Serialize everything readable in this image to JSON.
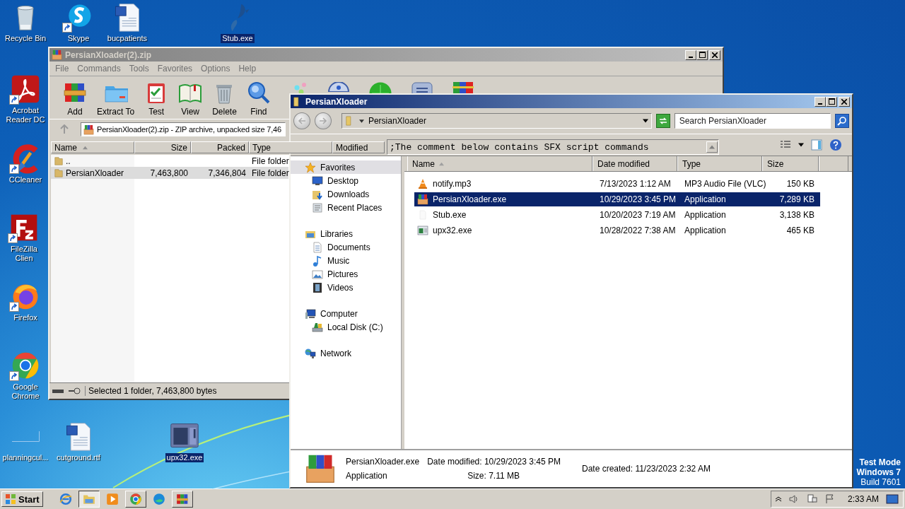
{
  "desktop_icons": [
    {
      "label": "Recycle Bin",
      "kind": "bin",
      "shortcut": false,
      "selected": false
    },
    {
      "label": "Skype",
      "kind": "skype",
      "shortcut": true,
      "selected": false
    },
    {
      "label": "bucpatients",
      "kind": "document",
      "shortcut": false,
      "selected": false
    },
    {
      "label": "Stub.exe",
      "kind": "feather",
      "shortcut": false,
      "selected": true
    },
    {
      "label": "Acrobat Reader DC",
      "kind": "acrobat",
      "shortcut": true,
      "selected": false
    },
    {
      "label": "CCleaner",
      "kind": "cleaner",
      "shortcut": true,
      "selected": false
    },
    {
      "label": "FileZilla Clien",
      "kind": "filezilla",
      "shortcut": true,
      "selected": false
    },
    {
      "label": "Firefox",
      "kind": "firefox",
      "shortcut": true,
      "selected": false
    },
    {
      "label": "Google Chrome",
      "kind": "chrome",
      "shortcut": true,
      "selected": false
    },
    {
      "label": "planningcul...",
      "kind": "blank",
      "shortcut": false,
      "selected": false
    },
    {
      "label": "cutground.rtf",
      "kind": "document",
      "shortcut": false,
      "selected": false
    },
    {
      "label": "upx32.exe",
      "kind": "window",
      "shortcut": false,
      "selected": true
    }
  ],
  "archiver": {
    "title": "PersianXloader(2).zip",
    "active": false,
    "menu": [
      "File",
      "Commands",
      "Tools",
      "Favorites",
      "Options",
      "Help"
    ],
    "toolbar": [
      {
        "label": "Add",
        "kind": "add"
      },
      {
        "label": "Extract To",
        "kind": "extract"
      },
      {
        "label": "Test",
        "kind": "test"
      },
      {
        "label": "View",
        "kind": "view"
      },
      {
        "label": "Delete",
        "kind": "delete"
      },
      {
        "label": "Find",
        "kind": "find"
      }
    ],
    "path": "PersianXloader(2).zip - ZIP archive, unpacked size 7,46",
    "columns": [
      "Name",
      "Size",
      "Packed",
      "Type",
      "Modified"
    ],
    "rows": [
      {
        "name": "..",
        "type": "File folder",
        "selected": false
      },
      {
        "name": "PersianXloader",
        "size": "7,463,800",
        "packed": "7,346,804",
        "type": "File folder",
        "selected": true
      }
    ],
    "comment": ";The comment below contains SFX script commands",
    "status": "Selected 1 folder, 7,463,800 bytes"
  },
  "explorer": {
    "title": "PersianXloader",
    "active": true,
    "address": "PersianXloader",
    "search": {
      "placeholder": "Search PersianXloader"
    },
    "nav": [
      {
        "label": "Favorites",
        "kind": "star",
        "selected": true,
        "children": [
          {
            "label": "Desktop",
            "kind": "desktop",
            "selected": false
          },
          {
            "label": "Downloads",
            "kind": "downloads",
            "selected": false
          },
          {
            "label": "Recent Places",
            "kind": "recent",
            "selected": false
          }
        ]
      },
      {
        "label": "Libraries",
        "kind": "library",
        "selected": false,
        "children": [
          {
            "label": "Documents",
            "kind": "documents",
            "selected": false
          },
          {
            "label": "Music",
            "kind": "music",
            "selected": false
          },
          {
            "label": "Pictures",
            "kind": "pictures",
            "selected": false
          },
          {
            "label": "Videos",
            "kind": "videos",
            "selected": false
          }
        ]
      },
      {
        "label": "Computer",
        "kind": "computer",
        "selected": false,
        "children": [
          {
            "label": "Local Disk (C:)",
            "kind": "disk",
            "selected": false
          }
        ]
      },
      {
        "label": "Network",
        "kind": "network",
        "selected": false
      }
    ],
    "columns": [
      "Name",
      "Date modified",
      "Type",
      "Size"
    ],
    "files": [
      {
        "name": "notify.mp3",
        "date": "7/13/2023 1:12 AM",
        "type": "MP3 Audio File (VLC)",
        "size": "150 KB",
        "kind": "audio",
        "selected": false
      },
      {
        "name": "PersianXloader.exe",
        "date": "10/29/2023 3:45 PM",
        "type": "Application",
        "size": "7,289 KB",
        "kind": "archive",
        "selected": true
      },
      {
        "name": "Stub.exe",
        "date": "10/20/2023 7:19 AM",
        "type": "Application",
        "size": "3,138 KB",
        "kind": "blank",
        "selected": false
      },
      {
        "name": "upx32.exe",
        "date": "10/28/2022 7:38 AM",
        "type": "Application",
        "size": "465 KB",
        "kind": "window",
        "selected": false
      }
    ],
    "details": {
      "kind": "archive",
      "name": "PersianXloader.exe",
      "type": "Application",
      "modified": "Date modified: 10/29/2023 3:45 PM",
      "size": "Size: 7.11 MB",
      "created": "Date created: 11/23/2023 2:32 AM"
    }
  },
  "os_notice": [
    "Test Mode",
    "Windows 7",
    "Build 7601"
  ],
  "taskbar": {
    "start": "Start",
    "apps": [
      {
        "kind": "ie",
        "running": false
      },
      {
        "kind": "folder",
        "running": true,
        "selected": true
      },
      {
        "kind": "media",
        "running": false
      },
      {
        "kind": "chrome",
        "running": true,
        "selected": false
      },
      {
        "kind": "edge",
        "running": false
      },
      {
        "kind": "archive",
        "running": true,
        "selected": false
      }
    ],
    "clock": "2:33 AM"
  }
}
